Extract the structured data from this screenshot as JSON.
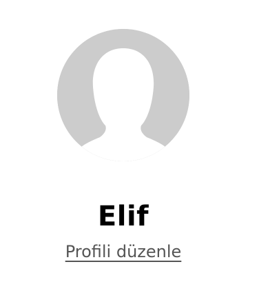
{
  "profile": {
    "avatar_icon": "default-user-silhouette-icon",
    "name": "Elif",
    "edit_label": "Profili düzenle"
  },
  "colors": {
    "avatar_background": "#cccccc",
    "avatar_silhouette": "#ffffff",
    "link_text": "#555555",
    "name_text": "#000000"
  }
}
